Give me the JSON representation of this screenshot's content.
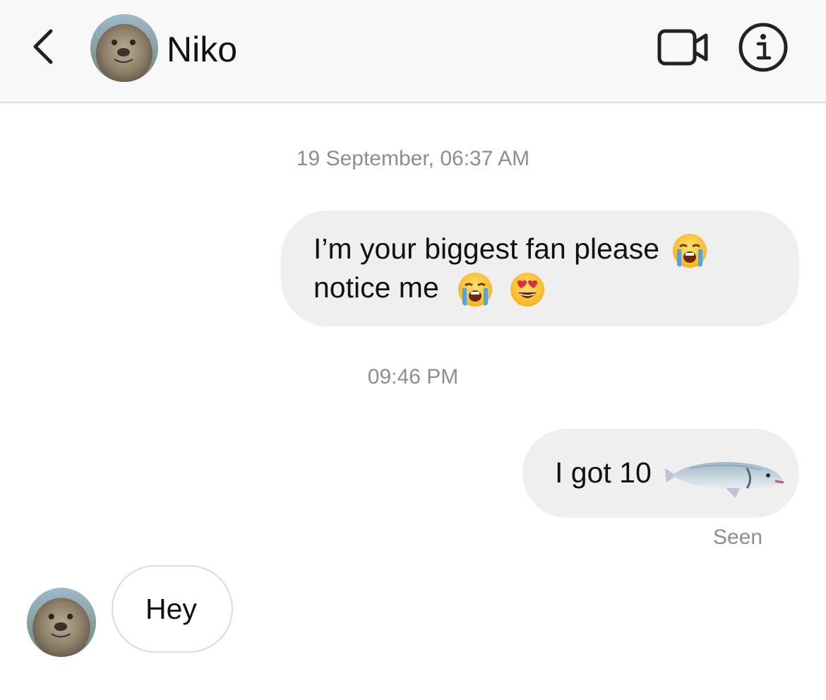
{
  "header": {
    "contact_name": "Niko",
    "back_icon": "chevron-left-icon",
    "video_icon": "video-camera-icon",
    "info_icon": "info-icon"
  },
  "messages": [
    {
      "type": "timestamp",
      "text": "19 September, 06:37 AM"
    },
    {
      "type": "outgoing",
      "text_line1": "I’m your biggest fan please",
      "text_line2": "notice me",
      "emojis": [
        "loudly-crying-face",
        "loudly-crying-face",
        "heart-eyes-face"
      ]
    },
    {
      "type": "timestamp",
      "text": "09:46 PM"
    },
    {
      "type": "outgoing",
      "text": "I got 10",
      "sticker": "fish-image"
    },
    {
      "type": "status",
      "text": "Seen"
    },
    {
      "type": "incoming",
      "text": "Hey",
      "sender_avatar": "seal-avatar"
    }
  ],
  "colors": {
    "header_bg": "#f8f8f8",
    "outgoing_bubble": "#efefef",
    "incoming_border": "#dbdbdb",
    "meta_text": "#8e8e8e"
  }
}
